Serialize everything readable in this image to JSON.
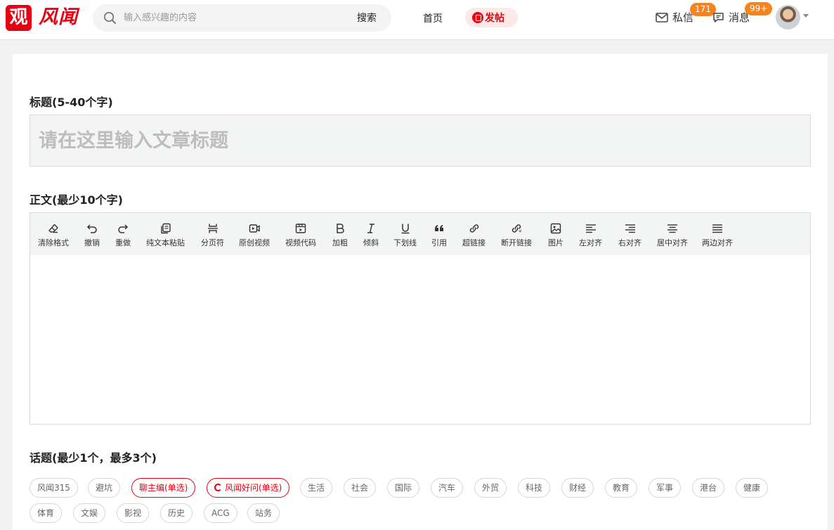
{
  "header": {
    "logo_char": "观",
    "brand": "风闻",
    "search_placeholder": "输入感兴趣的内容",
    "search_button": "搜索",
    "nav_home": "首页",
    "post_button": "发帖",
    "messages_label": "私信",
    "messages_count": "171",
    "notifications_label": "消息",
    "notifications_count": "99+"
  },
  "form": {
    "title_label": "标题(5-40个字)",
    "title_placeholder": "请在这里输入文章标题",
    "body_label": "正文(最少10个字)",
    "topic_label": "话题(最少1个，最多3个)"
  },
  "toolbar": [
    {
      "label": "清除格式",
      "icon": "eraser-icon"
    },
    {
      "label": "撤销",
      "icon": "undo-icon"
    },
    {
      "label": "重做",
      "icon": "redo-icon"
    },
    {
      "label": "纯文本粘贴",
      "icon": "paste-text-icon"
    },
    {
      "label": "分页符",
      "icon": "page-break-icon"
    },
    {
      "label": "原创视频",
      "icon": "video-icon"
    },
    {
      "label": "视频代码",
      "icon": "video-code-icon"
    },
    {
      "label": "加粗",
      "icon": "bold-icon"
    },
    {
      "label": "倾斜",
      "icon": "italic-icon"
    },
    {
      "label": "下划线",
      "icon": "underline-icon"
    },
    {
      "label": "引用",
      "icon": "quote-icon"
    },
    {
      "label": "超链接",
      "icon": "link-icon"
    },
    {
      "label": "断开链接",
      "icon": "unlink-icon"
    },
    {
      "label": "图片",
      "icon": "image-icon"
    },
    {
      "label": "左对齐",
      "icon": "align-left-icon"
    },
    {
      "label": "右对齐",
      "icon": "align-right-icon"
    },
    {
      "label": "居中对齐",
      "icon": "align-center-icon"
    },
    {
      "label": "两边对齐",
      "icon": "align-justify-icon"
    }
  ],
  "topics": [
    {
      "label": "风闻315",
      "style": "normal"
    },
    {
      "label": "避坑",
      "style": "normal"
    },
    {
      "label": "聊主编(单选)",
      "style": "red"
    },
    {
      "label": "风闻好问(单选)",
      "style": "red-icon"
    },
    {
      "label": "生活",
      "style": "normal"
    },
    {
      "label": "社会",
      "style": "normal"
    },
    {
      "label": "国际",
      "style": "normal"
    },
    {
      "label": "汽车",
      "style": "normal"
    },
    {
      "label": "外贸",
      "style": "normal"
    },
    {
      "label": "科技",
      "style": "normal"
    },
    {
      "label": "财经",
      "style": "normal"
    },
    {
      "label": "教育",
      "style": "normal"
    },
    {
      "label": "军事",
      "style": "normal"
    },
    {
      "label": "港台",
      "style": "normal"
    },
    {
      "label": "健康",
      "style": "normal"
    },
    {
      "label": "体育",
      "style": "normal"
    },
    {
      "label": "文娱",
      "style": "normal"
    },
    {
      "label": "影视",
      "style": "normal"
    },
    {
      "label": "历史",
      "style": "normal"
    },
    {
      "label": "ACG",
      "style": "normal"
    },
    {
      "label": "站务",
      "style": "normal"
    }
  ],
  "colors": {
    "brand": "#e60012",
    "badge": "#f5841f"
  }
}
